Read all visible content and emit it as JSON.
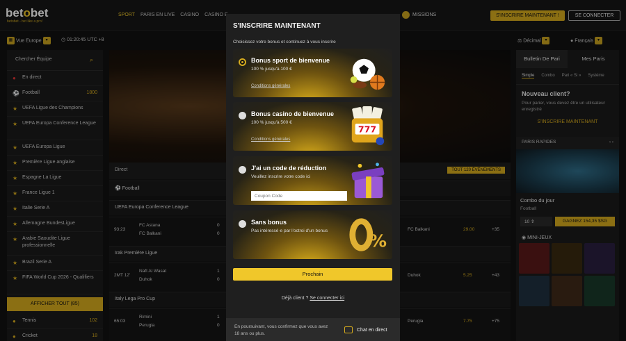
{
  "brand": {
    "logo_a": "bet",
    "logo_o": "o",
    "logo_b": "bet",
    "tagline": "betobet - bet like a pro!"
  },
  "nav": [
    "SPORT",
    "PARIS EN LIVE",
    "CASINO",
    "CASINO E"
  ],
  "missions": "MISSIONS",
  "signup_btn": "S'INSCRIRE MAINTENANT !",
  "login_btn": "SE CONNECTER",
  "subbar": {
    "view": "Vue Europe",
    "time": "01:20:45 UTC +8",
    "odds_format": "Décimal",
    "language": "Français"
  },
  "sidebar": {
    "search_placeholder": "Chercher Équipe",
    "items": [
      {
        "label": "En direct",
        "count": ""
      },
      {
        "label": "Football",
        "count": "1800"
      },
      {
        "label": "UEFA Ligue des Champions",
        "count": ""
      },
      {
        "label": "UEFA Europa Conference League",
        "count": ""
      },
      {
        "label": "UEFA Europa Ligue",
        "count": ""
      },
      {
        "label": "Première Ligue anglaise",
        "count": ""
      },
      {
        "label": "Espagne La Ligue",
        "count": ""
      },
      {
        "label": "France Ligue 1",
        "count": ""
      },
      {
        "label": "Italie Serie A",
        "count": ""
      },
      {
        "label": "Allemagne BundesLigue",
        "count": ""
      },
      {
        "label": "Arabie Saoudite Ligue professionnelle",
        "count": ""
      },
      {
        "label": "Brazil Serie A",
        "count": ""
      },
      {
        "label": "FIFA World Cup 2026 - Qualifiers",
        "count": ""
      }
    ],
    "show_all": "AFFICHER TOUT (85)",
    "bottom": [
      {
        "label": "Tennis",
        "count": "102"
      },
      {
        "label": "Cricket",
        "count": "18"
      }
    ]
  },
  "center": {
    "direct": "Direct",
    "all_events": "TOUT 120 ÉVÉNEMENTS",
    "sport": "Football",
    "leagues": [
      "UEFA Europa Conference League",
      "Irak Première Ligue",
      "Italy Lega Pro Cup"
    ],
    "matches": [
      {
        "time": "93:23",
        "home": "FC Astana",
        "away": "FC Balkani",
        "s1": "0",
        "s2": "0",
        "team": "FC Balkani",
        "odd": "29.00",
        "more": "+35"
      },
      {
        "time": "2MT 12'",
        "home": "Naft Al Wasat",
        "away": "Duhok",
        "s1": "1",
        "s2": "0",
        "team": "Duhok",
        "odd": "5.25",
        "more": "+43"
      },
      {
        "time": "65:03",
        "home": "Rimini",
        "away": "Perugia",
        "s1": "1",
        "s2": "0",
        "team": "Perugia",
        "odd": "7.75",
        "more": "+75"
      }
    ]
  },
  "right": {
    "tabs": [
      "Bulletin De Pari",
      "Mes Paris"
    ],
    "subtabs": [
      "Simple",
      "Combo",
      "Pari « Si »",
      "Système"
    ],
    "new_title": "Nouveau client?",
    "new_text": "Pour parier, vous devez être un utilisateur enregistré",
    "new_cta": "S'INSCRIRE MAINTENANT",
    "quick": "PARIS RAPIDES",
    "combo_title": "Combo du jour",
    "combo_sub": "Football",
    "bet_amount": "10",
    "win_label": "GAGNEZ 154,35 $SG",
    "minijeux": "MINI-JEUX"
  },
  "modal": {
    "title": "S'INSCRIRE MAINTENANT",
    "subtitle": "Choisissez votre bonus et continuez à vous inscrire",
    "cards": [
      {
        "title": "Bonus sport de bienvenue",
        "sub": "100 % jusqu'à 100 €",
        "link": "Conditions générales",
        "selected": true,
        "art": "sport-balls-icon"
      },
      {
        "title": "Bonus casino de bienvenue",
        "sub": "100 % jusqu'à 500 €",
        "link": "Conditions générales",
        "selected": false,
        "art": "slot-machine-icon"
      },
      {
        "title": "J'ai un code de réduction",
        "sub": "Veuillez inscrire votre code ici",
        "link": "",
        "selected": false,
        "art": "gift-box-icon"
      },
      {
        "title": "Sans bonus",
        "sub": "Pas intéressé·e par l'octroi d'un bonus",
        "link": "",
        "selected": false,
        "art": "zero-percent-icon"
      }
    ],
    "promo_placeholder": "Coupon Code",
    "next": "Prochain",
    "already": "Déjà client ?",
    "login_link": "Se connecter ici",
    "footer": "En poursuivant, vous confirmez que vous avez 18 ans ou plus.",
    "chat": "Chat en direct"
  },
  "colors": {
    "accent": "#d6ab1e",
    "bg": "#111111",
    "panel": "#1f1f1f"
  }
}
